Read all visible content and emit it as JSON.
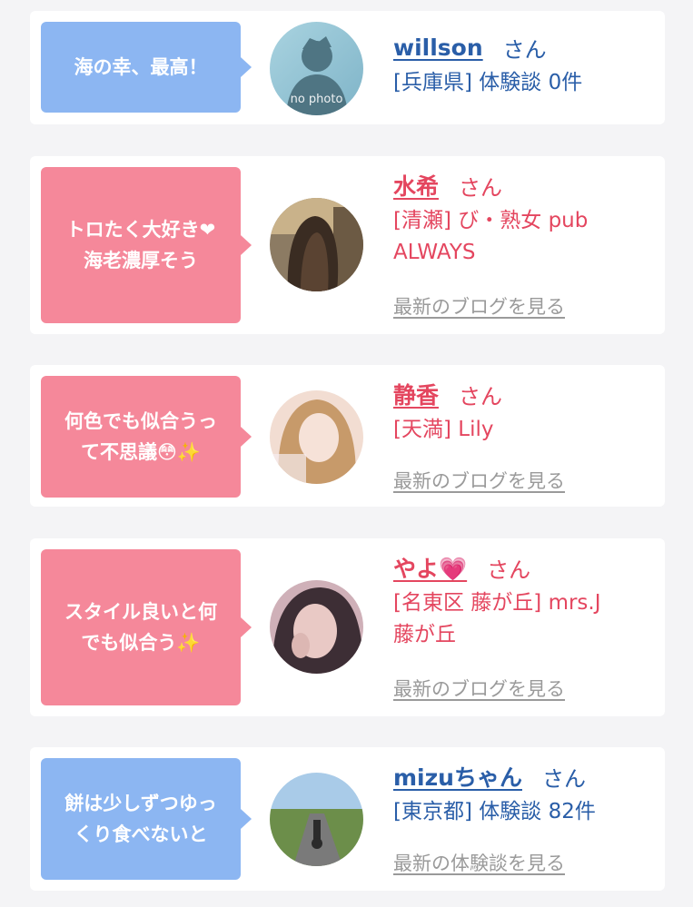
{
  "suffix": "さん",
  "cards": [
    {
      "comment": "海の幸、最高！",
      "name": "willson",
      "shop": "[兵庫県] 体験談 0件",
      "avatar": "no-photo",
      "avatar_text": "no photo"
    },
    {
      "comment_line1": "トロたく大好き❤",
      "comment_line2": "海老濃厚そう",
      "name": "水希",
      "shop_line1": "[清瀬] び・熟女 pub",
      "shop_line2": "ALWAYS",
      "more": "最新のブログを見る",
      "avatar": "photo-long-hair"
    },
    {
      "comment_line1": "何色でも似合うっ",
      "comment_line2": "て不思議😳✨",
      "name": "静香",
      "shop": "[天満] Lily",
      "more": "最新のブログを見る",
      "avatar": "photo-blonde"
    },
    {
      "comment_line1": "スタイル良いと何",
      "comment_line2": "でも似合う✨",
      "name": "やよ💗",
      "shop_line1": "[名東区 藤が丘] mrs.J",
      "shop_line2": "藤が丘",
      "more": "最新のブログを見る",
      "avatar": "photo-face"
    },
    {
      "comment_line1": "餅は少しずつゆっ",
      "comment_line2": "くり食べないと",
      "name": "mizuちゃん",
      "shop": "[東京都] 体験談 82件",
      "more": "最新の体験談を見る",
      "avatar": "photo-road"
    }
  ],
  "colors": {
    "blue_bubble": "#8cb6f2",
    "pink_bubble": "#f5889a",
    "blue_text": "#2a5ea8",
    "pink_text": "#e4465f"
  }
}
